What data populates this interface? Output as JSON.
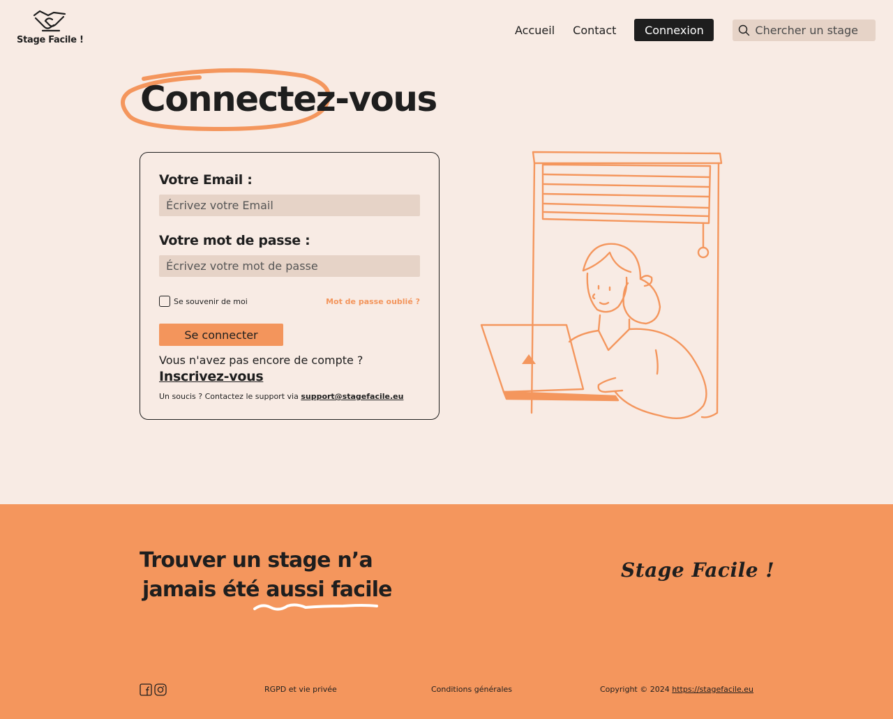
{
  "header": {
    "brand": "Stage Facile !",
    "nav": [
      "Accueil",
      "Contact"
    ],
    "login_button": "Connexion",
    "search_placeholder": "Chercher un stage"
  },
  "page_title": "Connectez-vous",
  "form": {
    "email_label": "Votre Email :",
    "email_placeholder": "Écrivez votre Email",
    "password_label": "Votre mot de passe :",
    "password_placeholder": "Écrivez votre mot de passe",
    "remember_label": "Se souvenir de moi",
    "remember_checked": false,
    "forgot_link": "Mot de passe oublié ?",
    "submit_button": "Se connecter",
    "no_account_text": "Vous n'avez pas encore de compte ?",
    "signup_link": "Inscrivez-vous",
    "support_text": "Un soucis ? Contactez le support via",
    "support_email": "support@stagefacile.eu"
  },
  "footer": {
    "tagline_line1": "Trouver un stage n’a",
    "tagline_line2_prefix": "jamais été ",
    "tagline_line2_highlight": "aussi facile",
    "brand": "Stage Facile !",
    "social_icons": [
      "facebook-icon",
      "instagram-icon"
    ],
    "rgpd_link": "RGPD et vie privée",
    "terms_link": "Conditions générales",
    "copyright_text": "Copyright © 2024",
    "copyright_link": "https://stagefacile.eu"
  },
  "colors": {
    "background": "#f8ebe4",
    "accent": "#f4965d",
    "dark": "#1e1e1e",
    "input_bg": "#e6d3c7"
  }
}
